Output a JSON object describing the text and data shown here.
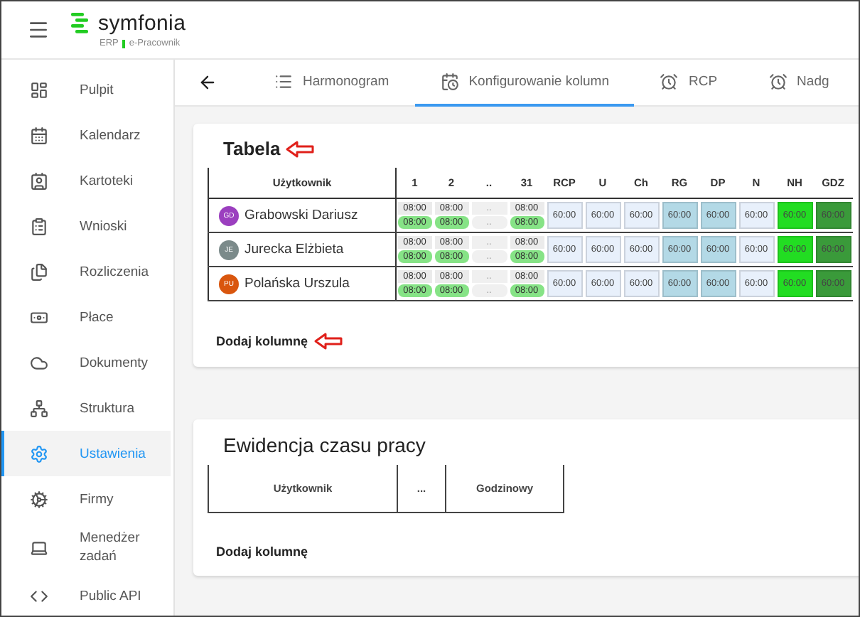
{
  "header": {
    "logo": "symfonia",
    "product": "ERP",
    "module": "e-Pracownik"
  },
  "sidebar": {
    "items": [
      {
        "label": "Pulpit",
        "selected": false
      },
      {
        "label": "Kalendarz",
        "selected": false
      },
      {
        "label": "Kartoteki",
        "selected": false
      },
      {
        "label": "Wnioski",
        "selected": false
      },
      {
        "label": "Rozliczenia",
        "selected": false
      },
      {
        "label": "Płace",
        "selected": false
      },
      {
        "label": "Dokumenty",
        "selected": false
      },
      {
        "label": "Struktura",
        "selected": false
      },
      {
        "label": "Ustawienia",
        "selected": true
      },
      {
        "label": "Firmy",
        "selected": false
      },
      {
        "label": "Menedżer zadań",
        "selected": false
      },
      {
        "label": "Public API",
        "selected": false
      }
    ]
  },
  "tabs": [
    {
      "label": "Harmonogram",
      "selected": false
    },
    {
      "label": "Konfigurowanie kolumn",
      "selected": true
    },
    {
      "label": "RCP",
      "selected": false
    },
    {
      "label": "Nadg",
      "selected": false
    }
  ],
  "tabela": {
    "title": "Tabela",
    "marked": true,
    "add_label": "Dodaj kolumnę",
    "add_marked": true,
    "columns": [
      {
        "label": "Użytkownik",
        "kind": "user"
      },
      {
        "label": "1",
        "kind": "day"
      },
      {
        "label": "2",
        "kind": "day"
      },
      {
        "label": "..",
        "kind": "gap"
      },
      {
        "label": "31",
        "kind": "day"
      },
      {
        "label": "RCP",
        "kind": "value",
        "color": "#e8f0fb"
      },
      {
        "label": "U",
        "kind": "value",
        "color": "#e8f0fb"
      },
      {
        "label": "Ch",
        "kind": "value",
        "color": "#e8f0fb"
      },
      {
        "label": "RG",
        "kind": "value",
        "color": "#b3d9e6"
      },
      {
        "label": "DP",
        "kind": "value",
        "color": "#b3d9e6"
      },
      {
        "label": "N",
        "kind": "value",
        "color": "#e8f0fb"
      },
      {
        "label": "NH",
        "kind": "value",
        "color": "#22dd22"
      },
      {
        "label": "GDZ",
        "kind": "value",
        "color": "#3a9a3a"
      }
    ],
    "rows": [
      {
        "cells": [
          {
            "initials": "GD",
            "name": "Grabowski Dariusz",
            "color": "#9b3fbf"
          },
          {
            "top": "08:00",
            "bottom": "08:00"
          },
          {
            "top": "08:00",
            "bottom": "08:00"
          },
          {
            "top": "..",
            "bottom": ".."
          },
          {
            "top": "08:00",
            "bottom": "08:00"
          },
          "60:00",
          "60:00",
          "60:00",
          "60:00",
          "60:00",
          "60:00",
          "60:00",
          "60:00"
        ]
      },
      {
        "cells": [
          {
            "initials": "JE",
            "name": "Jurecka Elżbieta",
            "color": "#7b8a8a"
          },
          {
            "top": "08:00",
            "bottom": "08:00"
          },
          {
            "top": "08:00",
            "bottom": "08:00"
          },
          {
            "top": "..",
            "bottom": ".."
          },
          {
            "top": "08:00",
            "bottom": "08:00"
          },
          "60:00",
          "60:00",
          "60:00",
          "60:00",
          "60:00",
          "60:00",
          "60:00",
          "60:00"
        ]
      },
      {
        "cells": [
          {
            "initials": "PU",
            "name": "Polańska Urszula",
            "color": "#d9560e"
          },
          {
            "top": "08:00",
            "bottom": "08:00"
          },
          {
            "top": "08:00",
            "bottom": "08:00"
          },
          {
            "top": "..",
            "bottom": ".."
          },
          {
            "top": "08:00",
            "bottom": "08:00"
          },
          "60:00",
          "60:00",
          "60:00",
          "60:00",
          "60:00",
          "60:00",
          "60:00",
          "60:00"
        ]
      }
    ]
  },
  "ewidencja": {
    "title": "Ewidencja czasu pracy",
    "marked": false,
    "add_label": "Dodaj kolumnę",
    "add_marked": false,
    "columns": [
      "Użytkownik",
      "...",
      "Godzinowy"
    ]
  }
}
